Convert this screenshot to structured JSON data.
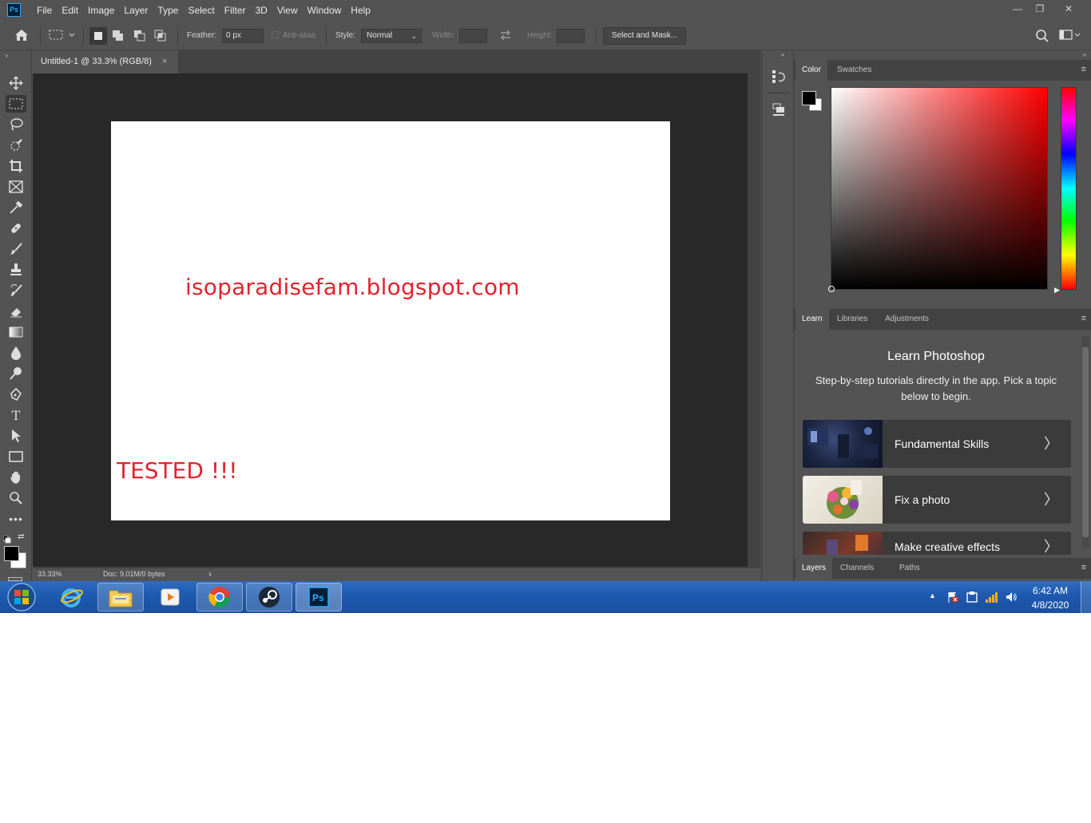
{
  "app": {
    "logo": "Ps",
    "menus": [
      "File",
      "Edit",
      "Image",
      "Layer",
      "Type",
      "Select",
      "Filter",
      "3D",
      "View",
      "Window",
      "Help"
    ],
    "window_controls": {
      "minimize": "—",
      "restore": "❐",
      "close": "✕"
    }
  },
  "options_bar": {
    "feather_label": "Feather:",
    "feather_value": "0 px",
    "antialias_label": "Anti-alias",
    "style_label": "Style:",
    "style_value": "Normal",
    "width_label": "Width:",
    "height_label": "Height:",
    "select_mask_label": "Select and Mask..."
  },
  "document": {
    "tab_title": "Untitled-1 @ 33.3% (RGB/8)",
    "tab_close": "×",
    "canvas_text_1": "isoparadisefam.blogspot.com",
    "canvas_text_2": "TESTED !!!",
    "canvas_text_color": "#e2232e"
  },
  "status": {
    "zoom": "33.33%",
    "doc_info": "Doc: 9.01M/0 bytes",
    "arrow": "›"
  },
  "color_panel": {
    "tabs": [
      "Color",
      "Swatches"
    ],
    "active_tab": "Color",
    "foreground": "#000000",
    "background": "#ffffff",
    "hue": "#ff0000"
  },
  "learn_panel": {
    "tabs": [
      "Learn",
      "Libraries",
      "Adjustments"
    ],
    "title": "Learn Photoshop",
    "subtitle": "Step-by-step tutorials directly in the app. Pick a topic below to begin.",
    "topics": [
      {
        "label": "Fundamental Skills"
      },
      {
        "label": "Fix a photo"
      },
      {
        "label": "Make creative effects"
      }
    ]
  },
  "layers_panel": {
    "tabs": [
      "Layers",
      "Channels",
      "Paths"
    ]
  },
  "taskbar": {
    "time": "6:42 AM",
    "date": "4/8/2020",
    "apps": [
      "start-orb",
      "internet-explorer",
      "file-explorer",
      "media-player",
      "chrome",
      "steam",
      "photoshop"
    ]
  }
}
